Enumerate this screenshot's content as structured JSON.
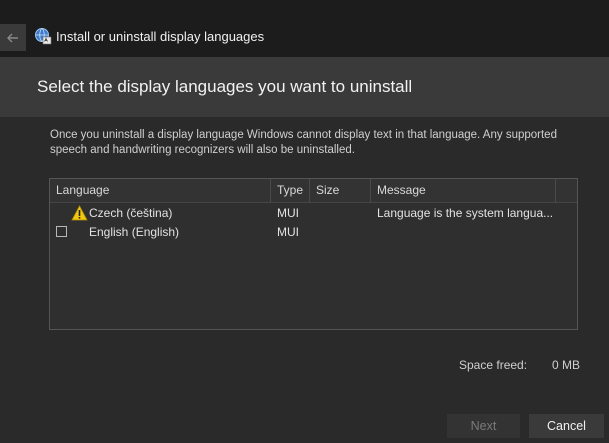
{
  "window": {
    "title": "Install or uninstall display languages",
    "icons": {
      "back": "back-arrow-icon",
      "app": "language-icon"
    }
  },
  "header": {
    "title": "Select the display languages you want to uninstall"
  },
  "description": "Once you uninstall a display language Windows cannot display text in that language. Any supported speech and handwriting recognizers will also be uninstalled.",
  "table": {
    "columns": [
      "Language",
      "Type",
      "Size",
      "Message"
    ],
    "rows": [
      {
        "icon": "warning-icon",
        "language": "Czech (čeština)",
        "type": "MUI",
        "size": "",
        "message": "Language is the system langua..."
      },
      {
        "icon": "checkbox",
        "language": "English (English)",
        "type": "MUI",
        "size": "",
        "message": ""
      }
    ]
  },
  "footer": {
    "space_freed_label": "Space freed:",
    "space_freed_value": "0 MB",
    "next_label": "Next",
    "cancel_label": "Cancel"
  },
  "colors": {
    "background": "#1e1e1e",
    "header_band": "#3a3a3a",
    "warning": "#f2c811"
  }
}
